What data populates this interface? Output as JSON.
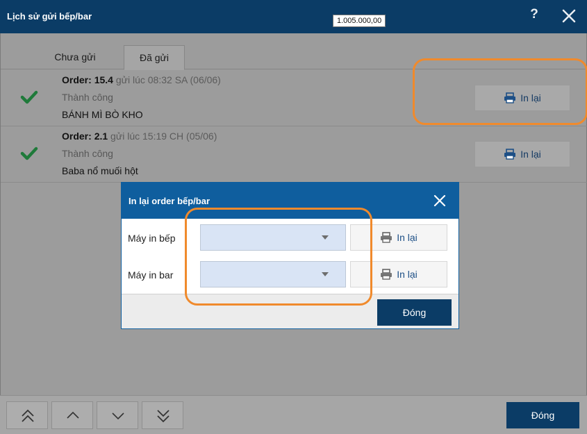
{
  "window": {
    "title": "Lịch sử gửi bếp/bar",
    "tooltip": "1.005.000,00",
    "help_label": "?"
  },
  "tabs": [
    {
      "label": "Chưa gửi",
      "selected": false
    },
    {
      "label": "Đã gửi",
      "selected": true
    }
  ],
  "orders": [
    {
      "order_prefix": "Order:",
      "order_no": "15.4",
      "sent_text": "gửi lúc 08:32 SA (06/06)",
      "status": "Thành công",
      "item": "BÁNH MÌ BÒ KHO",
      "reprint_label": "In lại",
      "status_icon": "check-icon"
    },
    {
      "order_prefix": "Order:",
      "order_no": "2.1",
      "sent_text": "gửi lúc 15:19 CH (05/06)",
      "status": "Thành công",
      "item": "Baba nổ muối hột",
      "reprint_label": "In lại",
      "status_icon": "check-icon"
    }
  ],
  "dialog": {
    "title": "In lại order bếp/bar",
    "kitchen_printer": {
      "label": "Máy in bếp",
      "value": "",
      "reprint_label": "In lại"
    },
    "bar_printer": {
      "label": "Máy in bar",
      "value": "",
      "reprint_label": "In lại"
    },
    "close_label": "Đóng"
  },
  "footer": {
    "close_label": "Đóng",
    "nav_icons": [
      "double-chevron-up-icon",
      "chevron-up-icon",
      "chevron-down-icon",
      "double-chevron-down-icon"
    ]
  },
  "colors": {
    "titlebar": "#0b3c66",
    "dialog_header": "#0f5e9e",
    "success_check": "#1f7a3a",
    "highlight": "#f08a2c",
    "select_bg": "#d9e4f5"
  }
}
